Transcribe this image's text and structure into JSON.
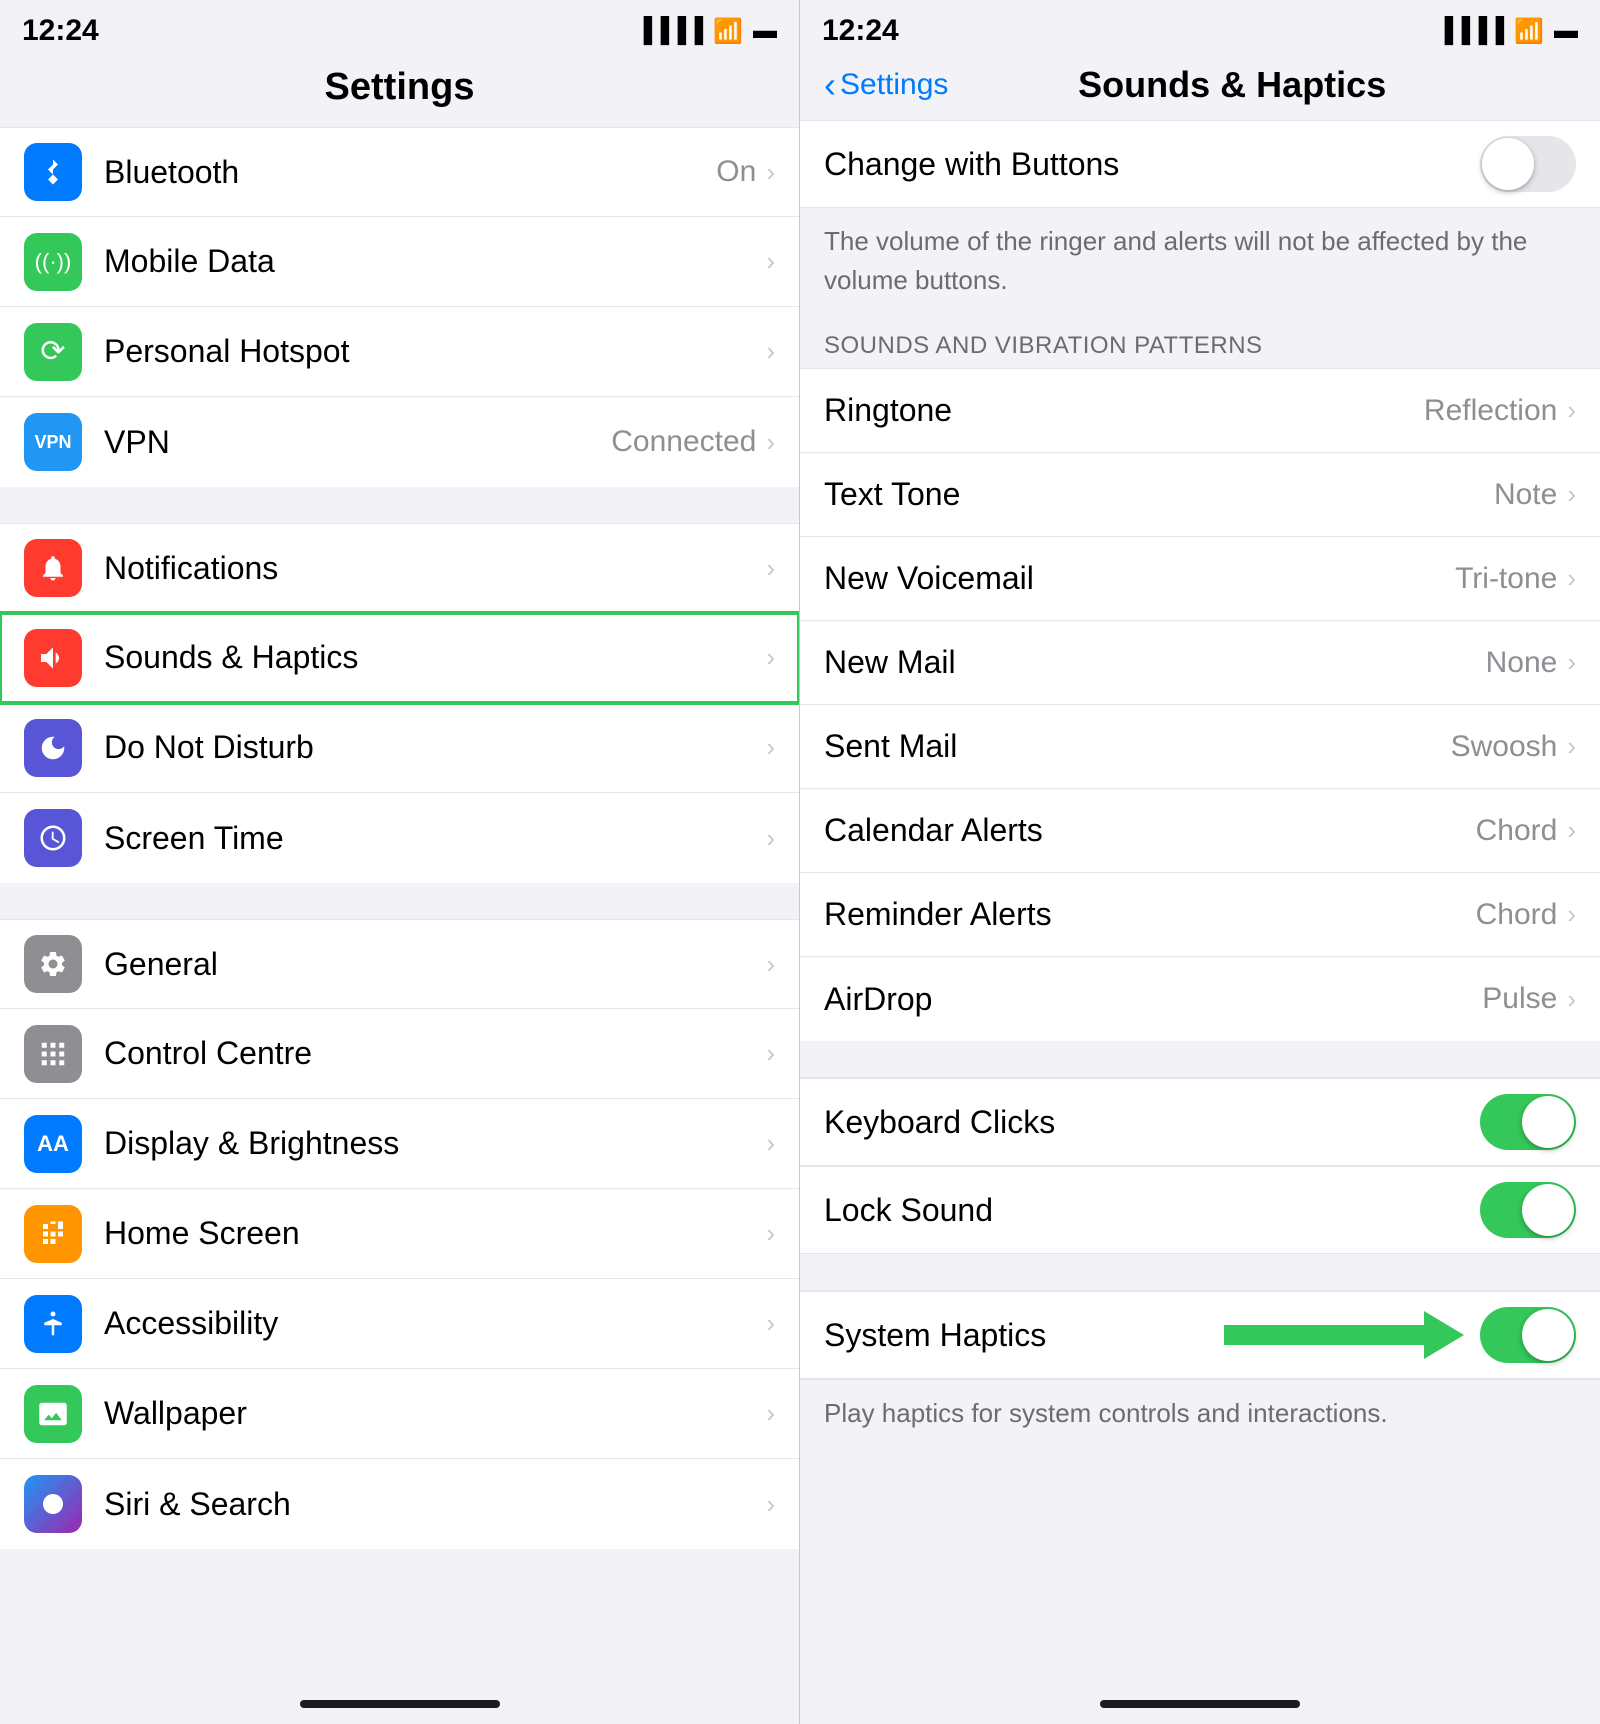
{
  "left": {
    "status": {
      "time": "12:24",
      "location_icon": "◀",
      "signal": "▐▐▐▐",
      "wifi": "wifi",
      "battery": "battery"
    },
    "title": "Settings",
    "groups": [
      {
        "id": "connectivity",
        "items": [
          {
            "id": "bluetooth",
            "label": "Bluetooth",
            "value": "On",
            "icon_char": "B",
            "icon_color": "icon-blue"
          },
          {
            "id": "mobile-data",
            "label": "Mobile Data",
            "value": "",
            "icon_char": "📶",
            "icon_color": "icon-green"
          },
          {
            "id": "personal-hotspot",
            "label": "Personal Hotspot",
            "value": "",
            "icon_char": "🔗",
            "icon_color": "icon-green"
          },
          {
            "id": "vpn",
            "label": "VPN",
            "value": "Connected",
            "icon_char": "VPN",
            "icon_color": "icon-vpn"
          }
        ]
      },
      {
        "id": "system1",
        "items": [
          {
            "id": "notifications",
            "label": "Notifications",
            "value": "",
            "icon_char": "🔔",
            "icon_color": "icon-red"
          },
          {
            "id": "sounds-haptics",
            "label": "Sounds & Haptics",
            "value": "",
            "icon_char": "🔊",
            "icon_color": "icon-sounds",
            "highlighted": true
          },
          {
            "id": "do-not-disturb",
            "label": "Do Not Disturb",
            "value": "",
            "icon_char": "🌙",
            "icon_color": "icon-purple"
          },
          {
            "id": "screen-time",
            "label": "Screen Time",
            "value": "",
            "icon_char": "⏱",
            "icon_color": "icon-purple2"
          }
        ]
      },
      {
        "id": "system2",
        "items": [
          {
            "id": "general",
            "label": "General",
            "value": "",
            "icon_char": "⚙",
            "icon_color": "icon-gray"
          },
          {
            "id": "control-centre",
            "label": "Control Centre",
            "value": "",
            "icon_char": "⊞",
            "icon_color": "icon-gray2"
          },
          {
            "id": "display-brightness",
            "label": "Display & Brightness",
            "value": "",
            "icon_char": "AA",
            "icon_color": "icon-blue2"
          },
          {
            "id": "home-screen",
            "label": "Home Screen",
            "value": "",
            "icon_char": "⊞",
            "icon_color": "icon-multi"
          },
          {
            "id": "accessibility",
            "label": "Accessibility",
            "value": "",
            "icon_char": "♿",
            "icon_color": "icon-acc"
          },
          {
            "id": "wallpaper",
            "label": "Wallpaper",
            "value": "",
            "icon_char": "🌸",
            "icon_color": "icon-wall"
          },
          {
            "id": "siri-search",
            "label": "Siri & Search",
            "value": "",
            "icon_char": "◉",
            "icon_color": "icon-siri"
          }
        ]
      }
    ]
  },
  "right": {
    "status": {
      "time": "12:24",
      "location_icon": "◀"
    },
    "nav_back": "Settings",
    "nav_title": "Sounds & Haptics",
    "change_with_buttons": {
      "label": "Change with Buttons",
      "state": "off"
    },
    "desc1": "The volume of the ringer and alerts will not be affected by the volume buttons.",
    "section_header": "SOUNDS AND VIBRATION PATTERNS",
    "sound_patterns": [
      {
        "id": "ringtone",
        "label": "Ringtone",
        "value": "Reflection"
      },
      {
        "id": "text-tone",
        "label": "Text Tone",
        "value": "Note"
      },
      {
        "id": "new-voicemail",
        "label": "New Voicemail",
        "value": "Tri-tone"
      },
      {
        "id": "new-mail",
        "label": "New Mail",
        "value": "None"
      },
      {
        "id": "sent-mail",
        "label": "Sent Mail",
        "value": "Swoosh"
      },
      {
        "id": "calendar-alerts",
        "label": "Calendar Alerts",
        "value": "Chord"
      },
      {
        "id": "reminder-alerts",
        "label": "Reminder Alerts",
        "value": "Chord"
      },
      {
        "id": "airdrop",
        "label": "AirDrop",
        "value": "Pulse"
      }
    ],
    "toggles": [
      {
        "id": "keyboard-clicks",
        "label": "Keyboard Clicks",
        "state": "on"
      },
      {
        "id": "lock-sound",
        "label": "Lock Sound",
        "state": "on"
      }
    ],
    "system_haptics": {
      "label": "System Haptics",
      "state": "on"
    },
    "desc2": "Play haptics for system controls and interactions."
  },
  "icons": {
    "chevron": "›",
    "back_chevron": "‹",
    "signal": "●●●●",
    "wifi_char": "≋",
    "battery_char": "▬"
  }
}
